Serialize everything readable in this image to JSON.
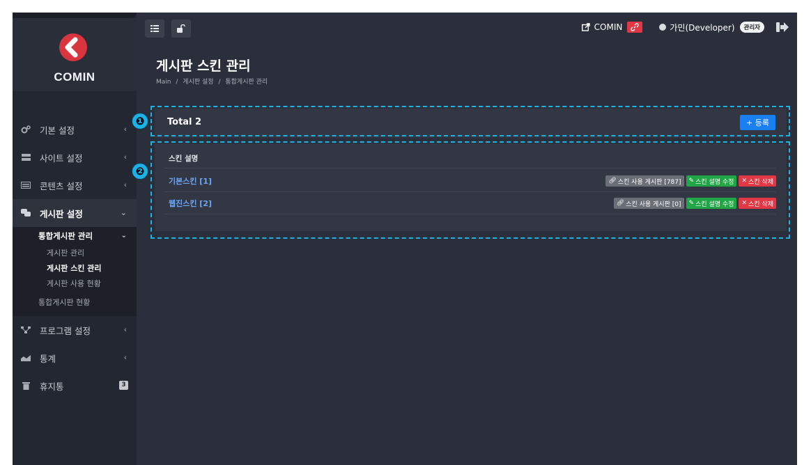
{
  "brand": {
    "name": "COMIN"
  },
  "sidebar": {
    "items": [
      {
        "label": "기본 설정",
        "icon": "gears-icon"
      },
      {
        "label": "사이트 설정",
        "icon": "server-icon"
      },
      {
        "label": "콘텐츠 설정",
        "icon": "keyboard-icon"
      },
      {
        "label": "게시판 설정",
        "icon": "comments-icon"
      },
      {
        "label": "프로그램 설정",
        "icon": "sitemap-icon"
      },
      {
        "label": "통계",
        "icon": "area-chart-icon"
      },
      {
        "label": "휴지통",
        "icon": "trash-icon",
        "badge": "3"
      }
    ],
    "board_sub": {
      "group_label": "통합게시판 관리",
      "items": [
        "게시판 관리",
        "게시판 스킨 관리",
        "게시판 사용 현황"
      ],
      "status_label": "통합게시판 현황"
    }
  },
  "topbar": {
    "site_link": "COMIN",
    "user_name": "가민(Developer)",
    "role_badge": "관리자"
  },
  "page": {
    "title": "게시판 스킨 관리",
    "breadcrumb": [
      "Main",
      "/",
      "게시판 설정",
      "/",
      "통합게시판 관리"
    ]
  },
  "markers": [
    "❶",
    "❷"
  ],
  "total": {
    "label": "Total 2",
    "add_label": "+ 등록"
  },
  "table": {
    "header": "스킨 설명",
    "rows": [
      {
        "name": "기본스킨 [1]",
        "usage": "스킨 사용 게시판 [787]",
        "edit": "스킨 설명 수정",
        "delete": "스킨 삭제"
      },
      {
        "name": "웹진스킨 [2]",
        "usage": "스킨 사용 게시판 [0]",
        "edit": "스킨 설명 수정",
        "delete": "스킨 삭제"
      }
    ]
  },
  "colors": {
    "accent_blue": "#1a7ff0",
    "success_green": "#20a644",
    "danger_red": "#e23744",
    "annotation_cyan": "#18b5e6"
  }
}
